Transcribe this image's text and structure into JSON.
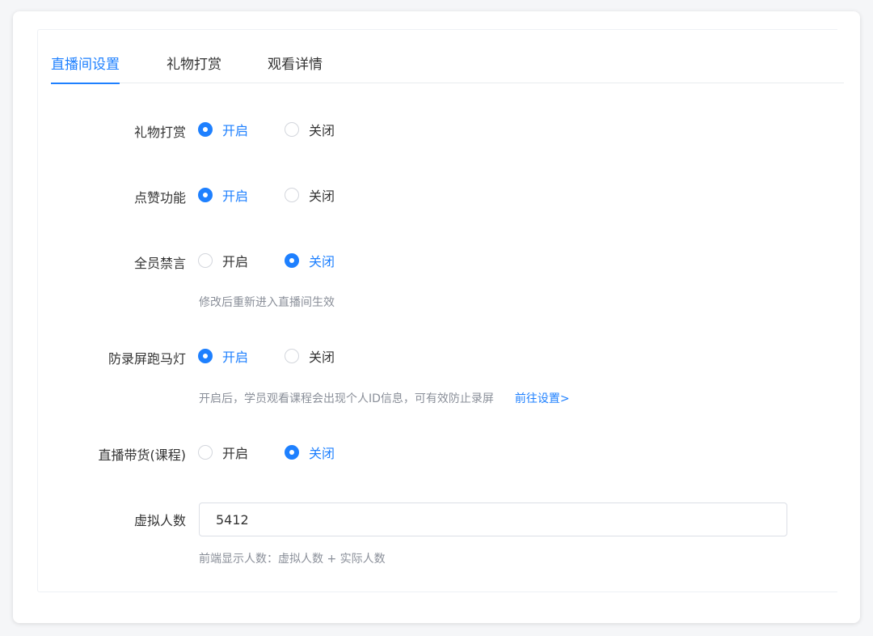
{
  "tabs": [
    {
      "label": "直播间设置",
      "active": true
    },
    {
      "label": "礼物打赏",
      "active": false
    },
    {
      "label": "观看详情",
      "active": false
    }
  ],
  "settings": {
    "gift": {
      "label": "礼物打赏",
      "on": "开启",
      "off": "关闭",
      "value": "on"
    },
    "like": {
      "label": "点赞功能",
      "on": "开启",
      "off": "关闭",
      "value": "on"
    },
    "mute_all": {
      "label": "全员禁言",
      "on": "开启",
      "off": "关闭",
      "value": "off",
      "hint": "修改后重新进入直播间生效"
    },
    "anti_record": {
      "label": "防录屏跑马灯",
      "on": "开启",
      "off": "关闭",
      "value": "on",
      "hint": "开启后，学员观看课程会出现个人ID信息，可有效防止录屏",
      "link": "前往设置>"
    },
    "live_sales": {
      "label": "直播带货(课程)",
      "on": "开启",
      "off": "关闭",
      "value": "off"
    },
    "virtual_count": {
      "label": "虚拟人数",
      "value": "5412",
      "hint": "前端显示人数：虚拟人数 + 实际人数"
    }
  },
  "colors": {
    "accent": "#1e80ff",
    "text": "#333333",
    "hint": "#8a8f99"
  }
}
